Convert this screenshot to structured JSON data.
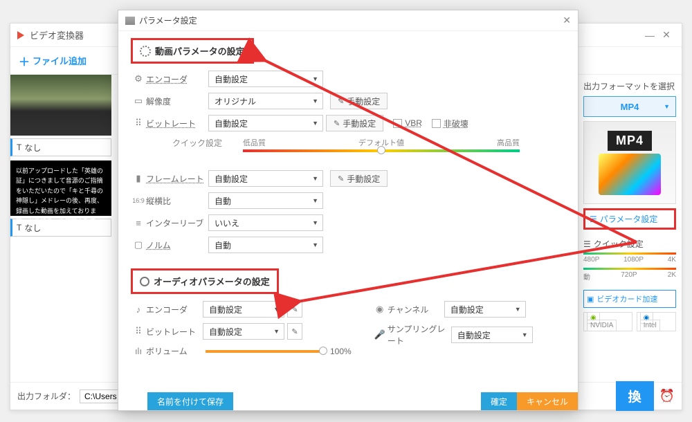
{
  "back": {
    "title": "ビデオ変換器",
    "add_file": "ファイル追加",
    "none": "なし",
    "desc": "以前アップロードした「英雄の証」につきまして音源のご指摘をいただいたので「キと千尋の神隠し」メドレーの後、再度、録画した動画を加えております。引き続き、ご視聴ください。",
    "out_label": "出力フォーマットを選択",
    "format": "MP4",
    "mp4_badge": "MP4",
    "param_btn": "パラメータ設定",
    "quick_label": "クイック設定",
    "quick_res": [
      "480P",
      "1080P",
      "4K"
    ],
    "quick_qual": [
      "動",
      "720P",
      "2K"
    ],
    "accel": "ビデオカード加速",
    "gpu1": "NVIDIA",
    "gpu2": "Intel",
    "folder_label": "出力フォルダ：",
    "folder_path": "C:\\Users",
    "convert": "換",
    "win_min": "—",
    "win_close": "✕"
  },
  "modal": {
    "title": "パラメータ設定",
    "section_video": "動画パラメータの設定",
    "section_audio": "オーディオパラメータの設定",
    "labels": {
      "encoder": "エンコーダ",
      "resolution": "解像度",
      "bitrate": "ビットレート",
      "quick": "クイック設定",
      "quality_low": "低品質",
      "quality_default": "デフォルト値",
      "quality_high": "高品質",
      "framerate": "フレームレート",
      "aspect": "縦横比",
      "interleave": "インターリーブ",
      "norm": "ノルム",
      "channel": "チャンネル",
      "sampling": "サンプリングレート",
      "volume": "ボリューム",
      "manual": "手動設定",
      "vbr": "VBR",
      "lossless": "非破壊"
    },
    "values": {
      "auto": "自動設定",
      "original": "オリジナル",
      "auto2": "自動",
      "no": "いいえ",
      "vol_pct": "100%"
    },
    "footer": {
      "save_as": "名前を付けて保存",
      "ok": "確定",
      "cancel": "キャンセル"
    }
  }
}
